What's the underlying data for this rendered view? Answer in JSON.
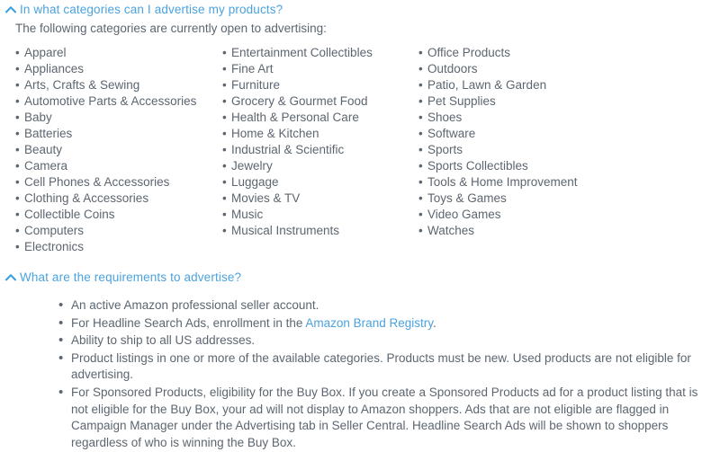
{
  "colors": {
    "link_blue": "#4aa3df",
    "body_text": "#5c6670",
    "background": "#ffffff"
  },
  "sections": {
    "categories": {
      "header_title": "In what categories can I advertise my products?",
      "chevron_icon": "chevron-up-icon",
      "intro": "The following categories are currently open to advertising:",
      "bullet_glyph": "•",
      "columns": [
        {
          "items": [
            "Apparel",
            "Appliances",
            "Arts, Crafts & Sewing",
            "Automotive Parts & Accessories",
            "Baby",
            "Batteries",
            "Beauty",
            "Camera",
            "Cell Phones & Accessories",
            "Clothing & Accessories",
            "Collectible Coins",
            "Computers",
            "Electronics"
          ]
        },
        {
          "items": [
            "Entertainment Collectibles",
            "Fine Art",
            "Furniture",
            "Grocery & Gourmet Food",
            "Health & Personal Care",
            "Home & Kitchen",
            "Industrial & Scientific",
            "Jewelry",
            "Luggage",
            "Movies & TV",
            "Music",
            "Musical Instruments"
          ]
        },
        {
          "items": [
            "Office Products",
            "Outdoors",
            "Patio, Lawn & Garden",
            "Pet Supplies",
            "Shoes",
            "Software",
            "Sports",
            "Sports Collectibles",
            "Tools & Home Improvement",
            "Toys & Games",
            "Video Games",
            "Watches"
          ]
        }
      ]
    },
    "requirements": {
      "header_title": "What are the requirements to advertise?",
      "chevron_icon": "chevron-up-icon",
      "bullet_glyph": "•",
      "items": [
        {
          "text": "An active Amazon professional seller account."
        },
        {
          "text_before": "For Headline Search Ads, enrollment in the ",
          "link_text": "Amazon Brand Registry",
          "text_after": "."
        },
        {
          "text": "Ability to ship to all US addresses."
        },
        {
          "text": "Product listings in one or more of the available categories. Products must be new. Used products are not eligible for advertising."
        },
        {
          "text": "For Sponsored Products, eligibility for the Buy Box. If you create a Sponsored Products ad for a product listing that is not eligible for the Buy Box, your ad will not display to Amazon shoppers. Ads that are not eligible are flagged in Campaign Manager under the Advertising tab in Seller Central. Headline Search Ads will be shown to shoppers regardless of who is winning the Buy Box."
        }
      ]
    }
  }
}
